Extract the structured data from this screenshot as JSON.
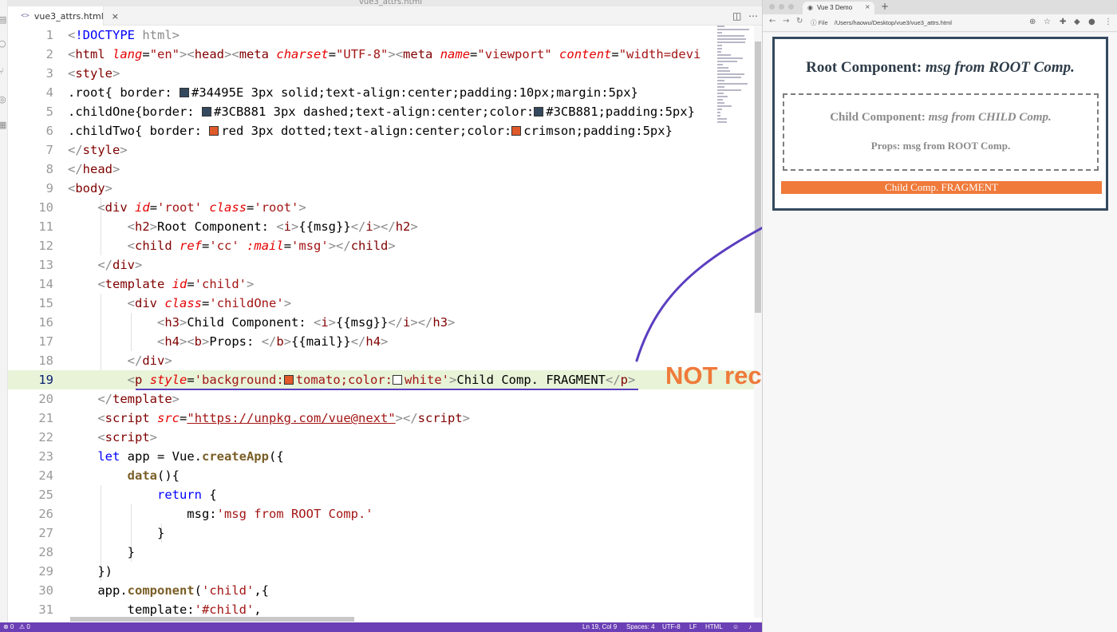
{
  "editor": {
    "window_title": "vue3_attrs.html",
    "tab_label": "vue3_attrs.html",
    "tab_icon": "<>",
    "active_line": 19,
    "lines": [
      {
        "n": 1,
        "html": "<span class=\"t-punc\">&lt;</span><span class=\"t-kw\">!DOCTYPE</span> <span class=\"t-attr\" style=\"font-style:normal;color:#8a8a8a\">html</span><span class=\"t-punc\">&gt;</span>"
      },
      {
        "n": 2,
        "html": "<span class=\"t-punc\">&lt;</span><span class=\"t-tag\">html</span> <span class=\"t-attr\">lang</span>=<span class=\"t-str\">\"en\"</span><span class=\"t-punc\">&gt;&lt;</span><span class=\"t-tag\">head</span><span class=\"t-punc\">&gt;&lt;</span><span class=\"t-tag\">meta</span> <span class=\"t-attr\">charset</span>=<span class=\"t-str\">\"UTF-8\"</span><span class=\"t-punc\">&gt;&lt;</span><span class=\"t-tag\">meta</span> <span class=\"t-attr\">name</span>=<span class=\"t-str\">\"viewport\"</span> <span class=\"t-attr\">content</span>=<span class=\"t-str\">\"width=devi</span>"
      },
      {
        "n": 3,
        "html": "<span class=\"t-punc\">&lt;</span><span class=\"t-tag\">style</span><span class=\"t-punc\">&gt;</span>"
      },
      {
        "n": 4,
        "html": ".root{ border: <span class=\"swatch\" style=\"background:#34495E\"></span>#34495E 3px solid;text-align:center;padding:10px;margin:5px}"
      },
      {
        "n": 5,
        "html": ".childOne{border: <span class=\"swatch\" style=\"background:#34495E\"></span>#3CB881 3px dashed;text-align:center;color:<span class=\"swatch\" style=\"background:#34495E\"></span>#3CB881;padding:5px}"
      },
      {
        "n": 6,
        "html": ".childTwo{ border: <span class=\"swatch\" style=\"background:#e0592a\"></span>red 3px dotted;text-align:center;color:<span class=\"swatch\" style=\"background:#e0592a\"></span>crimson;padding:5px}"
      },
      {
        "n": 7,
        "html": "<span class=\"t-punc\">&lt;/</span><span class=\"t-tag\">style</span><span class=\"t-punc\">&gt;</span>"
      },
      {
        "n": 8,
        "html": "<span class=\"t-punc\">&lt;/</span><span class=\"t-tag\">head</span><span class=\"t-punc\">&gt;</span>"
      },
      {
        "n": 9,
        "html": "<span class=\"t-punc\">&lt;</span><span class=\"t-tag\">body</span><span class=\"t-punc\">&gt;</span>"
      },
      {
        "n": 10,
        "html": "    <span class=\"t-punc\">&lt;</span><span class=\"t-tag\">div</span> <span class=\"t-attr\">id</span>=<span class=\"t-str\">'root'</span> <span class=\"t-attr\">class</span>=<span class=\"t-str\">'root'</span><span class=\"t-punc\">&gt;</span>"
      },
      {
        "n": 11,
        "html": "        <span class=\"t-punc\">&lt;</span><span class=\"t-tag\">h2</span><span class=\"t-punc\">&gt;</span>Root Component: <span class=\"t-punc\">&lt;</span><span class=\"t-tag\">i</span><span class=\"t-punc\">&gt;</span>{{msg}}<span class=\"t-punc\">&lt;/</span><span class=\"t-tag\">i</span><span class=\"t-punc\">&gt;&lt;/</span><span class=\"t-tag\">h2</span><span class=\"t-punc\">&gt;</span>"
      },
      {
        "n": 12,
        "html": "        <span class=\"t-punc\">&lt;</span><span class=\"t-tag\">child</span> <span class=\"t-attr\">ref</span>=<span class=\"t-str\">'cc'</span> <span class=\"t-attr\">:mail</span>=<span class=\"t-str\">'msg'</span><span class=\"t-punc\">&gt;&lt;/</span><span class=\"t-tag\">child</span><span class=\"t-punc\">&gt;</span>"
      },
      {
        "n": 13,
        "html": "    <span class=\"t-punc\">&lt;/</span><span class=\"t-tag\">div</span><span class=\"t-punc\">&gt;</span>"
      },
      {
        "n": 14,
        "html": "    <span class=\"t-punc\">&lt;</span><span class=\"t-tag\">template</span> <span class=\"t-attr\">id</span>=<span class=\"t-str\">'child'</span><span class=\"t-punc\">&gt;</span>"
      },
      {
        "n": 15,
        "html": "        <span class=\"t-punc\">&lt;</span><span class=\"t-tag\">div</span> <span class=\"t-attr\">class</span>=<span class=\"t-str\">'childOne'</span><span class=\"t-punc\">&gt;</span>"
      },
      {
        "n": 16,
        "html": "            <span class=\"t-punc\">&lt;</span><span class=\"t-tag\">h3</span><span class=\"t-punc\">&gt;</span>Child Component: <span class=\"t-punc\">&lt;</span><span class=\"t-tag\">i</span><span class=\"t-punc\">&gt;</span>{{msg}}<span class=\"t-punc\">&lt;/</span><span class=\"t-tag\">i</span><span class=\"t-punc\">&gt;&lt;/</span><span class=\"t-tag\">h3</span><span class=\"t-punc\">&gt;</span>"
      },
      {
        "n": 17,
        "html": "            <span class=\"t-punc\">&lt;</span><span class=\"t-tag\">h4</span><span class=\"t-punc\">&gt;&lt;</span><span class=\"t-tag\">b</span><span class=\"t-punc\">&gt;</span>Props: <span class=\"t-punc\">&lt;/</span><span class=\"t-tag\">b</span><span class=\"t-punc\">&gt;</span>{{mail}}<span class=\"t-punc\">&lt;/</span><span class=\"t-tag\">h4</span><span class=\"t-punc\">&gt;</span>"
      },
      {
        "n": 18,
        "html": "        <span class=\"t-punc\">&lt;/</span><span class=\"t-tag\">div</span><span class=\"t-punc\">&gt;</span>"
      },
      {
        "n": 19,
        "html": "        <span class=\"t-punc\">&lt;</span><span class=\"t-tag\">p</span> <span class=\"t-attr\">style</span>=<span class=\"t-str\">'background:<span class=\"swatch\" style=\"background:#e0592a\"></span>tomato;color:<span class=\"swatch\" style=\"background:#ffffff\"></span>white'</span><span class=\"t-punc\">&gt;</span>Child Comp. FRAGMENT<span class=\"t-punc\">&lt;/</span><span class=\"t-tag\">p</span><span class=\"t-punc\">&gt;</span>"
      },
      {
        "n": 20,
        "html": "    <span class=\"t-punc\">&lt;/</span><span class=\"t-tag\">template</span><span class=\"t-punc\">&gt;</span>"
      },
      {
        "n": 21,
        "html": "    <span class=\"t-punc\">&lt;</span><span class=\"t-tag\">script</span> <span class=\"t-attr\">src</span>=<span class=\"t-str\" style=\"text-decoration:underline\">\"https://unpkg.com/vue@next\"</span><span class=\"t-punc\">&gt;&lt;/</span><span class=\"t-tag\">script</span><span class=\"t-punc\">&gt;</span>"
      },
      {
        "n": 22,
        "html": "    <span class=\"t-punc\">&lt;</span><span class=\"t-tag\">script</span><span class=\"t-punc\">&gt;</span>"
      },
      {
        "n": 23,
        "html": "    <span class=\"t-kw\">let</span> app = Vue.<span class=\"t-fn\">createApp</span>({"
      },
      {
        "n": 24,
        "html": "        <span class=\"t-fn\">data</span>(){"
      },
      {
        "n": 25,
        "html": "            <span class=\"t-kw\">return</span> {"
      },
      {
        "n": 26,
        "html": "                msg:<span class=\"t-str\">'msg from ROOT Comp.'</span>"
      },
      {
        "n": 27,
        "html": "            }"
      },
      {
        "n": 28,
        "html": "        }"
      },
      {
        "n": 29,
        "html": "    })"
      },
      {
        "n": 30,
        "html": "    app.<span class=\"t-fn\">component</span>(<span class=\"t-str\">'child'</span>,{"
      },
      {
        "n": 31,
        "html": "        template:<span class=\"t-str\">'#child'</span>,"
      }
    ],
    "status": {
      "errors": "⊗ 0",
      "warnings": "⚠ 0",
      "position": "Ln 19, Col 9",
      "spaces": "Spaces: 4",
      "encoding": "UTF-8",
      "eol": "LF",
      "language": "HTML"
    }
  },
  "annotation": {
    "text": "NOT recommended"
  },
  "browser": {
    "tab_title": "Vue 3 Demo",
    "url_scheme": "File",
    "url": "/Users/haowu/Desktop/vue3/vue3_attrs.html",
    "page": {
      "root_title_prefix": "Root Component: ",
      "root_msg": "msg from ROOT Comp.",
      "child_title_prefix": "Child Component: ",
      "child_msg": "msg from CHILD Comp.",
      "props_label": "Props: ",
      "props_value": "msg from ROOT Comp.",
      "fragment_text": "Child Comp. FRAGMENT"
    }
  }
}
